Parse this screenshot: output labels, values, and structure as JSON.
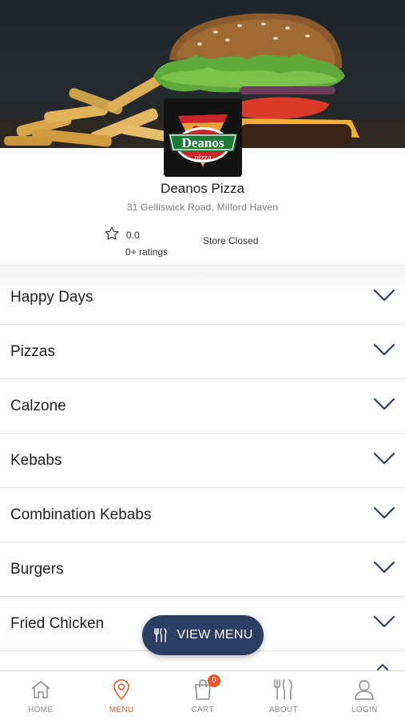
{
  "store": {
    "name": "Deanos Pizza",
    "address": "31 Gelliswick Road, Milford Haven",
    "rating_value": "0.0",
    "rating_count": "0+ ratings",
    "status": "Store Closed",
    "logo_text_main": "Deanos",
    "logo_text_sub": "pizza"
  },
  "menu": {
    "categories": [
      {
        "label": "Happy Days"
      },
      {
        "label": "Pizzas"
      },
      {
        "label": "Calzone"
      },
      {
        "label": "Kebabs"
      },
      {
        "label": "Combination Kebabs"
      },
      {
        "label": "Burgers"
      },
      {
        "label": "Fried Chicken"
      }
    ],
    "view_menu_label": "VIEW MENU"
  },
  "nav": {
    "items": [
      {
        "label": "HOME",
        "icon": "home-icon"
      },
      {
        "label": "MENU",
        "icon": "location-pin-icon",
        "active": true
      },
      {
        "label": "CART",
        "icon": "shopping-bag-icon",
        "badge": "0"
      },
      {
        "label": "ABOUT",
        "icon": "cutlery-icon"
      },
      {
        "label": "LOGIN",
        "icon": "user-icon"
      }
    ]
  },
  "colors": {
    "accent": "#e05a2a",
    "primary_dark": "#2d3e63",
    "logo_green": "#1f7a3a",
    "logo_red": "#c9252b"
  }
}
